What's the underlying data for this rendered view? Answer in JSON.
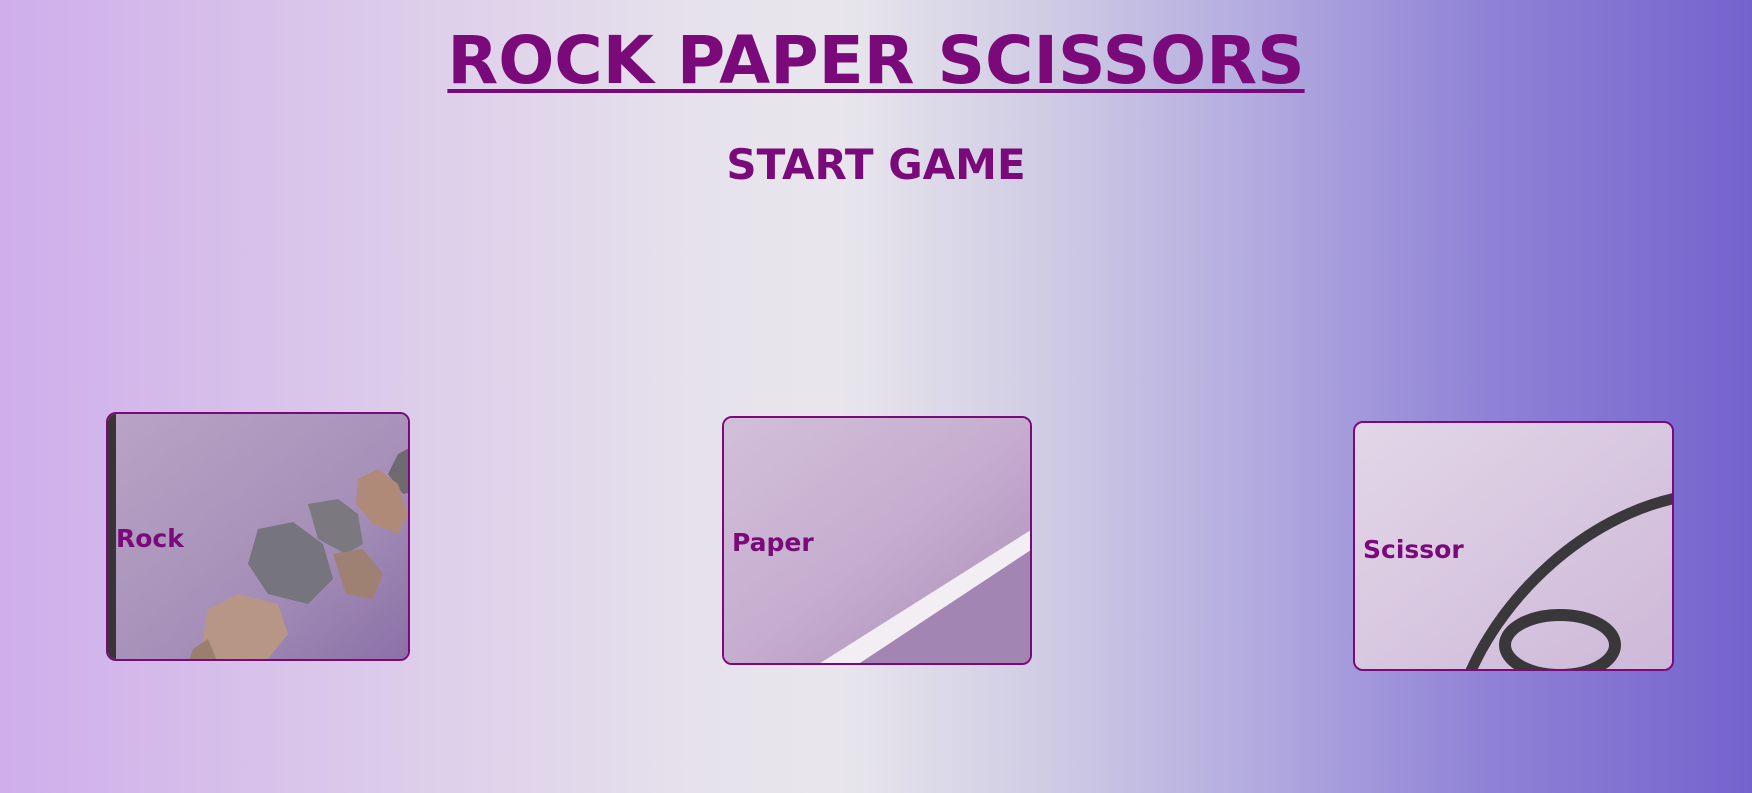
{
  "title": "ROCK PAPER SCISSORS",
  "start_button": "START GAME",
  "choices": [
    {
      "label": "Rock",
      "icon": "rock-image"
    },
    {
      "label": "Paper",
      "icon": "paper-image"
    },
    {
      "label": "Scissor",
      "icon": "scissor-image"
    }
  ],
  "colors": {
    "accent": "#7a0a7a",
    "gradient_left": "#cfaeeb",
    "gradient_center": "#e8e6ec",
    "gradient_right": "#7563cd"
  }
}
